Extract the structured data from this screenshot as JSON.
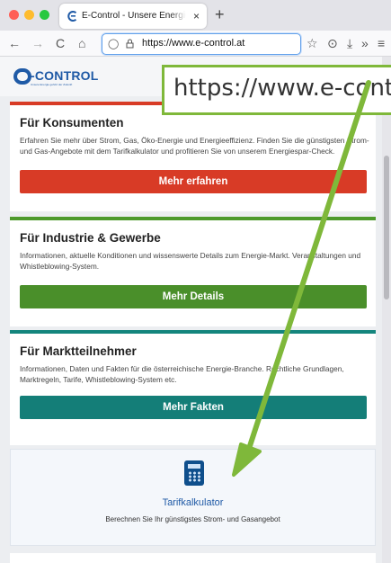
{
  "browser": {
    "tab_title": "E-Control - Unsere Energie gehört der Zukunft",
    "tab_close": "×",
    "new_tab": "+",
    "url": "https://www.e-control.at",
    "nav": {
      "back": "←",
      "forward": "→",
      "reload": "C",
      "home": "⌂",
      "star": "☆",
      "pocket": "⊙",
      "download": "⤓",
      "more": "»",
      "menu": "≡"
    }
  },
  "site": {
    "logo_text": "-CONTROL",
    "logo_tagline": "Unsere Energie gehört der Zukunft"
  },
  "cards": [
    {
      "title": "Für Konsumenten",
      "text": "Erfahren Sie mehr über Strom, Gas, Öko-Energie und Energieeffizienz. Finden Sie die günstigsten Strom- und Gas-Angebote mit dem Tarifkalkulator und profitieren Sie von unserem Energiespar-Check.",
      "button": "Mehr erfahren",
      "accent": "#d83b26"
    },
    {
      "title": "Für Industrie & Gewerbe",
      "text": "Informationen, aktuelle Konditionen und wissenswerte Details zum Energie-Markt. Veranstaltungen und Whistleblowing-System.",
      "button": "Mehr Details",
      "accent": "#4a8f2a"
    },
    {
      "title": "Für Marktteilnehmer",
      "text": "Informationen, Daten und Fakten für die österreichische Energie-Branche. Rechtliche Grundlagen, Marktregeln, Tarife, Whistleblowing-System etc.",
      "button": "Mehr Fakten",
      "accent": "#147e78"
    }
  ],
  "tarif": {
    "title": "Tarifkalkulator",
    "subtitle": "Berechnen Sie Ihr günstigstes Strom- und Gasangebot",
    "icon": "calculator-icon"
  },
  "annotation": {
    "callout_text": "https://www.e-control.at",
    "color": "#7fb83a"
  }
}
